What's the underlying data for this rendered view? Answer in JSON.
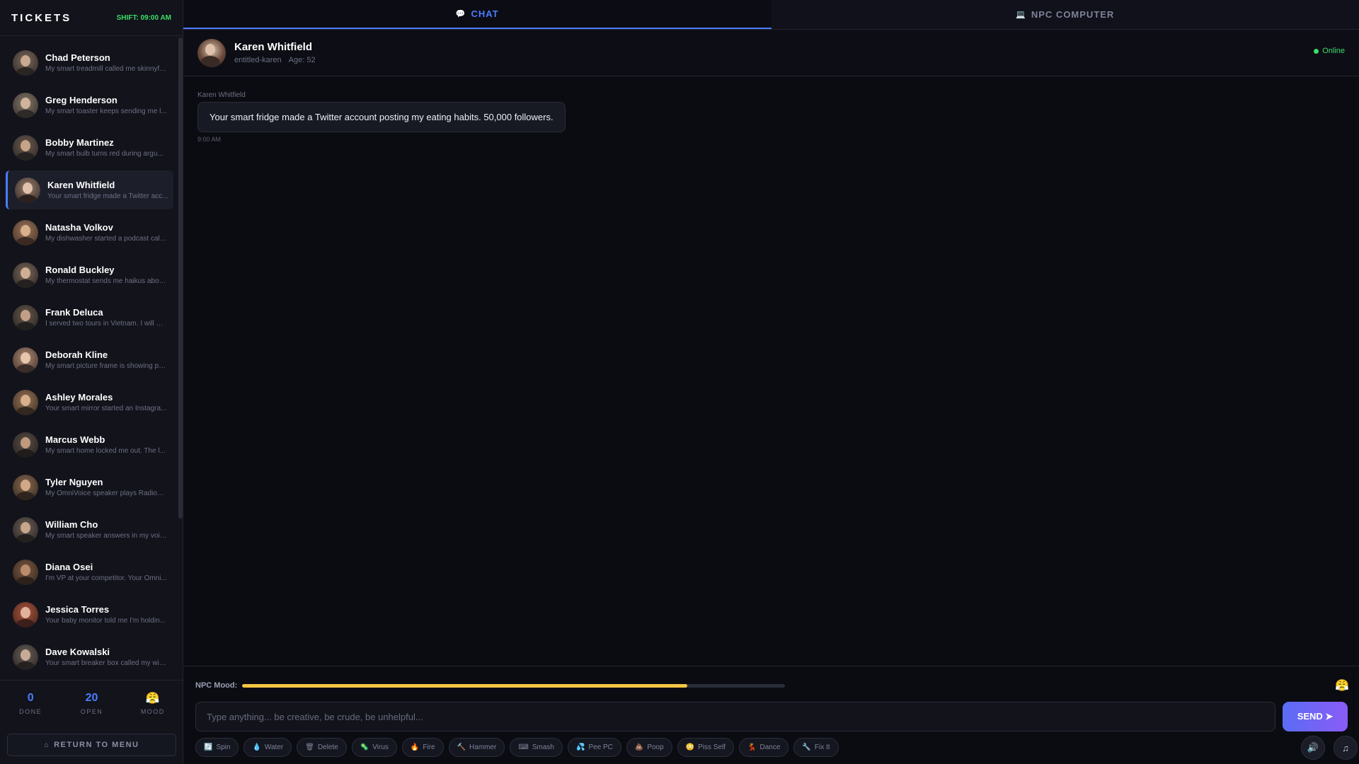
{
  "sidebar": {
    "title": "TICKETS",
    "shift": "SHIFT: 09:00 AM",
    "tickets": [
      {
        "name": "Chad Peterson",
        "preview": "My smart treadmill called me skinnyfa..."
      },
      {
        "name": "Greg Henderson",
        "preview": "My smart toaster keeps sending me l..."
      },
      {
        "name": "Bobby Martinez",
        "preview": "My smart bulb turns red during argu..."
      },
      {
        "name": "Karen Whitfield",
        "preview": "Your smart fridge made a Twitter acc..."
      },
      {
        "name": "Natasha Volkov",
        "preview": "My dishwasher started a podcast call..."
      },
      {
        "name": "Ronald Buckley",
        "preview": "My thermostat sends me haikus abou..."
      },
      {
        "name": "Frank Deluca",
        "preview": "I served two tours in Vietnam. I will N..."
      },
      {
        "name": "Deborah Kline",
        "preview": "My smart picture frame is showing ph..."
      },
      {
        "name": "Ashley Morales",
        "preview": "Your smart mirror started an Instagra..."
      },
      {
        "name": "Marcus Webb",
        "preview": "My smart home locked me out. The l..."
      },
      {
        "name": "Tyler Nguyen",
        "preview": "My OmniVoice speaker plays Radiohe..."
      },
      {
        "name": "William Cho",
        "preview": "My smart speaker answers in my voic..."
      },
      {
        "name": "Diana Osei",
        "preview": "I'm VP at your competitor. Your Omni..."
      },
      {
        "name": "Jessica Torres",
        "preview": "Your baby monitor told me I'm holdin..."
      },
      {
        "name": "Dave Kowalski",
        "preview": "Your smart breaker box called my wiri..."
      }
    ],
    "active_index": 3,
    "stats": {
      "done_value": "0",
      "done_label": "DONE",
      "open_value": "20",
      "open_label": "OPEN",
      "mood_emoji": "😤",
      "mood_label": "MOOD"
    },
    "return_label": "RETURN TO MENU"
  },
  "tabs": [
    {
      "label": "CHAT",
      "icon": "💬",
      "icon_name": "chat-bubble-icon",
      "active": true
    },
    {
      "label": "NPC COMPUTER",
      "icon": "💻",
      "icon_name": "computer-icon",
      "active": false
    }
  ],
  "chat": {
    "name": "Karen Whitfield",
    "handle": "entitled-karen",
    "age": "Age: 52",
    "status": "Online",
    "messages": [
      {
        "sender": "Karen Whitfield",
        "text": "Your smart fridge made a Twitter account posting my eating habits. 50,000 followers.",
        "time": "9:00 AM"
      }
    ]
  },
  "mood": {
    "label": "NPC Mood:",
    "level": 0.82,
    "emoji": "😤",
    "color": "#f5c542"
  },
  "input": {
    "placeholder": "Type anything... be creative, be crude, be unhelpful...",
    "send_label": "SEND ➤"
  },
  "actions": [
    {
      "label": "Spin",
      "icon": "🔄",
      "icon_name": "spin-icon"
    },
    {
      "label": "Water",
      "icon": "💧",
      "icon_name": "water-drop-icon"
    },
    {
      "label": "Delete",
      "icon": "🗑",
      "icon_name": "trash-icon"
    },
    {
      "label": "Virus",
      "icon": "🦠",
      "icon_name": "virus-icon"
    },
    {
      "label": "Fire",
      "icon": "🔥",
      "icon_name": "fire-icon"
    },
    {
      "label": "Hammer",
      "icon": "🔨",
      "icon_name": "hammer-icon"
    },
    {
      "label": "Smash",
      "icon": "⌨",
      "icon_name": "keyboard-icon"
    },
    {
      "label": "Pee PC",
      "icon": "💦",
      "icon_name": "splash-icon"
    },
    {
      "label": "Poop",
      "icon": "💩",
      "icon_name": "poop-icon"
    },
    {
      "label": "Piss Self",
      "icon": "😳",
      "icon_name": "flushed-face-icon"
    },
    {
      "label": "Dance",
      "icon": "💃",
      "icon_name": "dance-icon"
    },
    {
      "label": "Fix It",
      "icon": "🔧",
      "icon_name": "wrench-icon"
    }
  ],
  "controls": {
    "sound_icon": "🔊",
    "music_icon": "♫"
  },
  "colors": {
    "accent": "#4a7dff",
    "online": "#3ddc6a",
    "mood": "#f5c542"
  }
}
